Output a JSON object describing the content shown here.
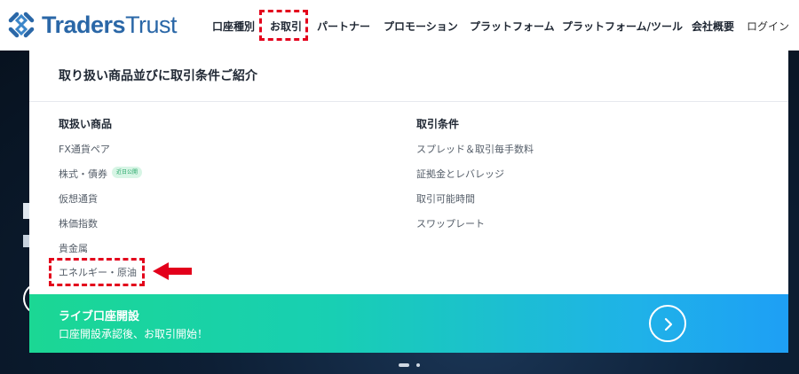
{
  "header": {
    "logo": "TradersTrust",
    "nav": [
      {
        "label": "口座種別"
      },
      {
        "label": "お取引"
      },
      {
        "label": "パートナー"
      },
      {
        "label": "プロモーション"
      },
      {
        "label": "プラットフォーム"
      },
      {
        "label": "プラットフォーム/ツール"
      },
      {
        "label": "会社概要"
      },
      {
        "label": "ログイン"
      }
    ]
  },
  "panel": {
    "title": "取り扱い商品並びに取引条件ご紹介",
    "products": {
      "heading": "取扱い商品",
      "items": [
        "FX通貨ペア",
        "株式・債券",
        "仮想通貨",
        "株価指数",
        "貴金属",
        "エネルギー・原油"
      ],
      "badge": "近日公開"
    },
    "conditions": {
      "heading": "取引条件",
      "items": [
        "スプレッド＆取引毎手数料",
        "証拠金とレバレッジ",
        "取引可能時間",
        "スワップレート"
      ]
    },
    "cta": {
      "title": "ライブ口座開設",
      "subtitle": "口座開設承認後、お取引開始！"
    }
  },
  "colors": {
    "brand": "#2a67a7",
    "highlight": "#e3001b",
    "cta_start": "#1bd794",
    "cta_end": "#1e9ff5"
  },
  "icons": [
    "traders-trust-logo-icon",
    "chevron-right-icon",
    "red-arrow-left-icon"
  ]
}
